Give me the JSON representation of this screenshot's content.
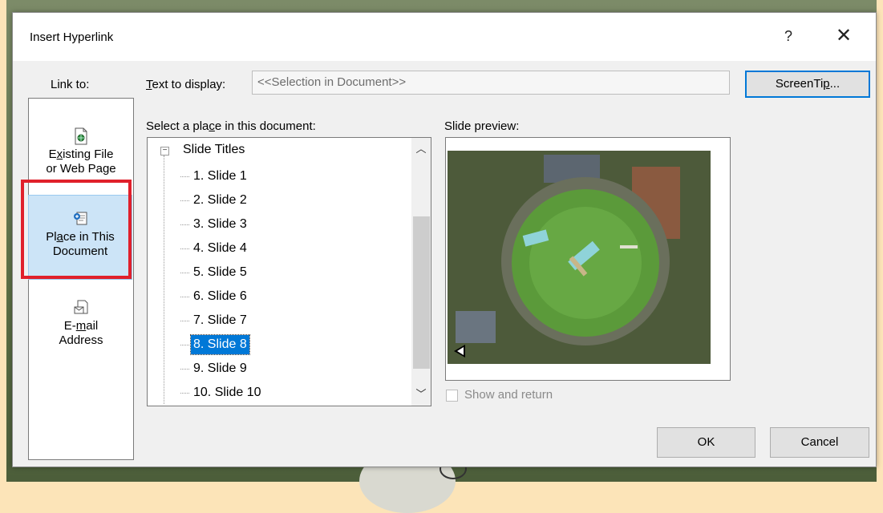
{
  "dialog": {
    "title": "Insert Hyperlink",
    "help_label": "?",
    "close_label": "✕"
  },
  "link_to": {
    "label": "Link to:",
    "items": [
      {
        "line1_pre": "E",
        "line1_u": "x",
        "line1_post": "isting File",
        "line2": "or Web Page",
        "icon": "existing-file-icon"
      },
      {
        "line1_pre": "Pl",
        "line1_u": "a",
        "line1_post": "ce in This",
        "line2": "Document",
        "icon": "place-in-document-icon",
        "selected": true
      },
      {
        "line1_pre": "E-",
        "line1_u": "m",
        "line1_post": "ail",
        "line2": "Address",
        "icon": "email-icon"
      }
    ]
  },
  "text_to_display": {
    "label_u": "T",
    "label_rest": "ext to display:",
    "value": "<<Selection in Document>>"
  },
  "screentip": {
    "pre": "ScreenTi",
    "u": "p",
    "post": "..."
  },
  "place": {
    "label_pre": "Select a pla",
    "label_u": "c",
    "label_post": "e in this document:",
    "root": "Slide Titles",
    "items": [
      "1. Slide 1",
      "2. Slide 2",
      "3. Slide 3",
      "4. Slide 4",
      "5. Slide 5",
      "6. Slide 6",
      "7. Slide 7",
      "8. Slide 8",
      "9. Slide 9",
      "10. Slide 10"
    ],
    "selected_index": 7
  },
  "preview": {
    "label": "Slide preview:",
    "show_and_return": "Show and return"
  },
  "buttons": {
    "ok": "OK",
    "cancel": "Cancel"
  },
  "colors": {
    "accent": "#0078D7",
    "highlight_box": "#E0202B",
    "selected_item_bg": "#CCE4F7"
  }
}
